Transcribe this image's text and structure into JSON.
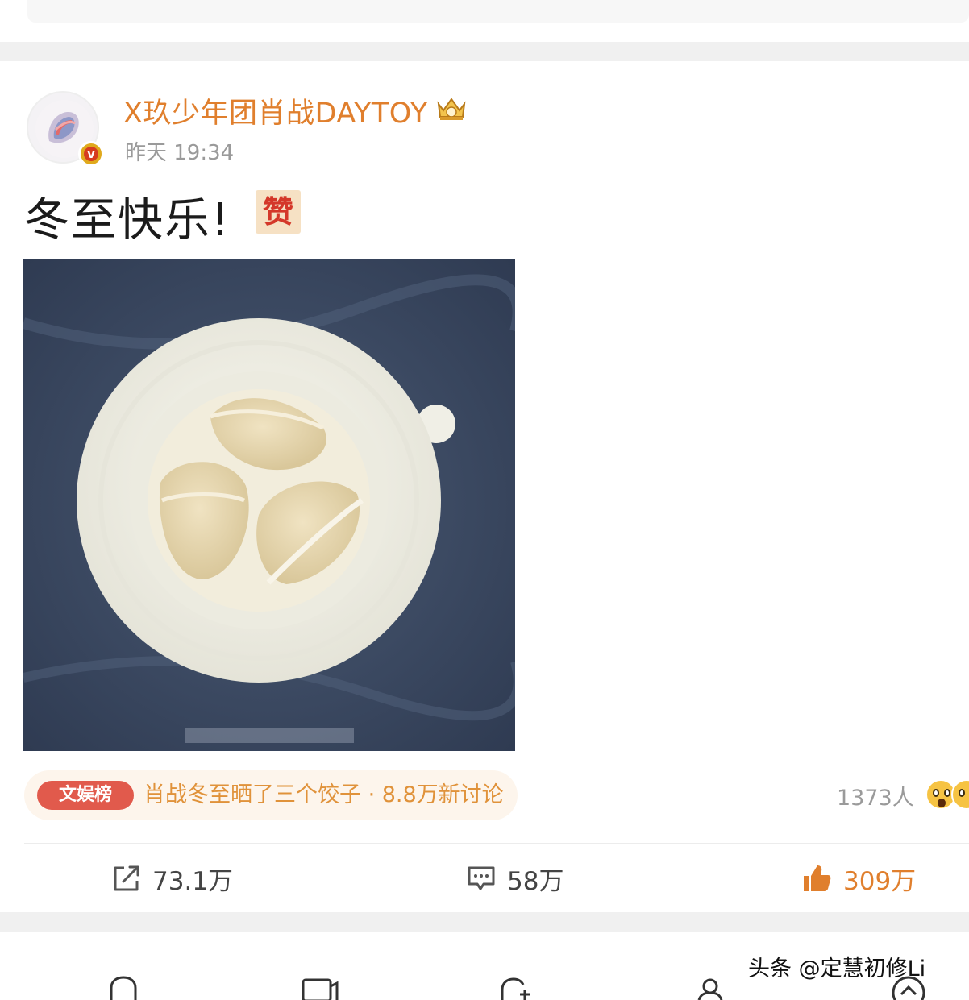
{
  "post": {
    "author_name": "X玖少年团肖战DAYTOY",
    "time": "昨天 19:34",
    "text": "冬至快乐!",
    "inline_emoji_text": "赞",
    "verified_mark": "v",
    "crown_icon": "crown-badge-icon"
  },
  "topic": {
    "tag": "文娱榜",
    "text": "肖战冬至晒了三个饺子 · 8.8万新讨论"
  },
  "reactions": {
    "count": "1373人"
  },
  "actions": {
    "repost": "73.1万",
    "comment": "58万",
    "like": "309万"
  },
  "watermark": "头条 @定慧初修Li",
  "colors": {
    "accent": "#e07f2d",
    "topic_text": "#e0923a",
    "topic_tag": "#e15a4c",
    "muted": "#9a9a9a"
  }
}
